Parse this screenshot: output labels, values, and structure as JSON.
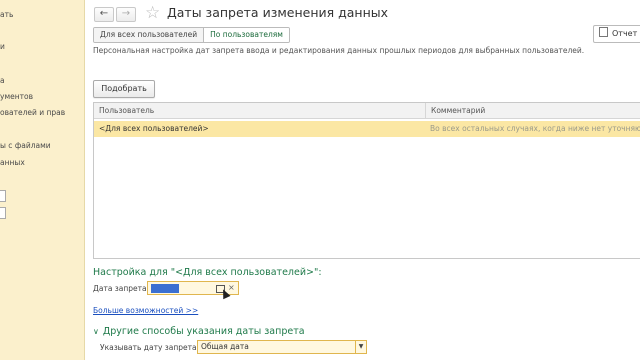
{
  "left_panel": {
    "items": [
      "ать",
      "и",
      "а",
      "ументов",
      "ователей и прав",
      "ы с файлами",
      "анных"
    ]
  },
  "header": {
    "back_icon": "arrow-left",
    "forward_icon": "arrow-right",
    "title": "Даты запрета изменения данных",
    "report_label": "Отчет"
  },
  "tabs": [
    {
      "label": "Для всех пользователей",
      "active": false
    },
    {
      "label": "По пользователям",
      "active": true
    }
  ],
  "description": "Персональная настройка дат запрета ввода и редактирования данных прошлых периодов для выбранных пользователей.",
  "pick_button": "Подобрать",
  "table": {
    "columns": [
      "Пользователь",
      "Комментарий"
    ],
    "rows": [
      {
        "user": "<Для всех пользователей>",
        "comment": "Во всех остальных случаях, когда ниже нет уточняющих"
      }
    ]
  },
  "settings": {
    "header": "Настройка для \"<Для всех пользователей>\":",
    "date_label": "Дата запрета:",
    "clear_symbol": "×",
    "more_link": "Больше возможностей >>"
  },
  "other_methods": {
    "header": "Другие способы указания даты запрета",
    "specify_label": "Указывать дату запрета:",
    "specify_value": "Общая дата"
  },
  "colors": {
    "accent_green": "#1f7a4a",
    "row_highlight": "#fbe7a4",
    "left_panel": "#fbf0cc",
    "link": "#1a4fbf"
  }
}
